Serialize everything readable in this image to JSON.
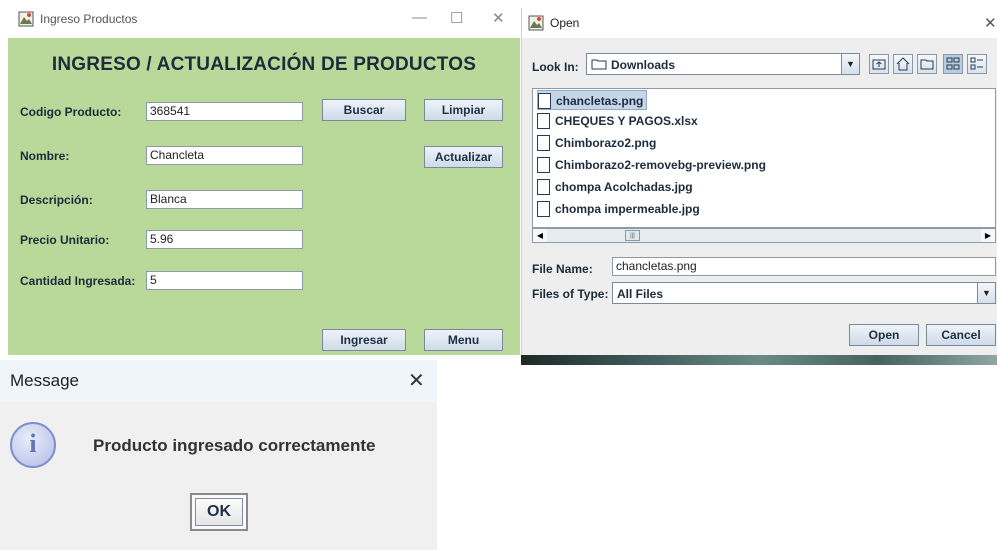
{
  "win1": {
    "title": "Ingreso Productos",
    "heading": "INGRESO / ACTUALIZACIÓN DE PRODUCTOS",
    "labels": {
      "codigo": "Codigo Producto:",
      "nombre": "Nombre:",
      "descripcion": "Descripción:",
      "precio": "Precio Unitario:",
      "cantidad": "Cantidad Ingresada:"
    },
    "values": {
      "codigo": "368541",
      "nombre": "Chancleta",
      "descripcion": "Blanca",
      "precio": "5.96",
      "cantidad": "5"
    },
    "buttons": {
      "buscar": "Buscar",
      "limpiar": "Limpiar",
      "actualizar": "Actualizar",
      "ingresar": "Ingresar",
      "menu": "Menu"
    },
    "controls": {
      "minimize": "—",
      "maximize": "☐",
      "close": "✕"
    },
    "bg_color": "#b9d99a"
  },
  "open_dialog": {
    "title": "Open",
    "close": "✕",
    "look_in_label": "Look In:",
    "look_in_value": "Downloads",
    "files": [
      "chancletas.png",
      "CHEQUES Y PAGOS.xlsx",
      "Chimborazo2.png",
      "Chimborazo2-removebg-preview.png",
      "chompa Acolchadas.jpg",
      "chompa impermeable.jpg"
    ],
    "selected_file": "chancletas.png",
    "file_name_label": "File Name:",
    "file_name_value": "chancletas.png",
    "files_of_type_label": "Files of Type:",
    "files_of_type_value": "All Files",
    "open_button": "Open",
    "cancel_button": "Cancel",
    "toolbar_icons": [
      "up-folder-icon",
      "home-icon",
      "new-folder-icon",
      "list-view-icon",
      "details-view-icon"
    ]
  },
  "message": {
    "title": "Message",
    "close": "✕",
    "icon_glyph": "i",
    "text": "Producto ingresado correctamente",
    "ok": "OK"
  }
}
